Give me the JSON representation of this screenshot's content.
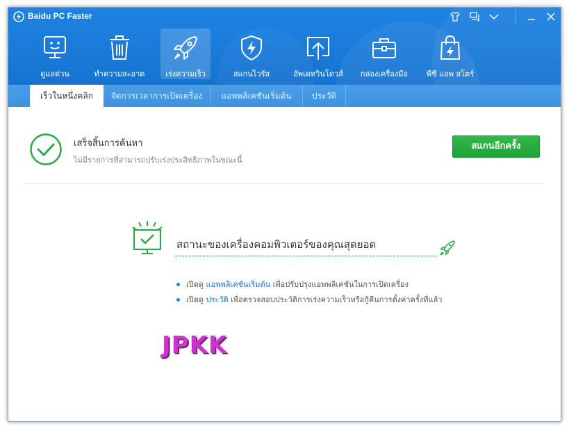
{
  "window": {
    "title": "Baidu PC Faster"
  },
  "nav": [
    {
      "label": "ดูแลด่วน",
      "icon": "monitor-face-icon"
    },
    {
      "label": "ทำความสะอาด",
      "icon": "trash-icon"
    },
    {
      "label": "เร่งความเร็ว",
      "icon": "rocket-icon"
    },
    {
      "label": "สแกนไวรัส",
      "icon": "shield-bolt-icon"
    },
    {
      "label": "อัพเดทวินโดวส์",
      "icon": "upload-icon"
    },
    {
      "label": "กล่องเครื่องมือ",
      "icon": "toolbox-icon"
    },
    {
      "label": "พีซี แอพ สโตร์",
      "icon": "shopping-bag-icon"
    }
  ],
  "tabs": [
    {
      "label": "เร็วในหนึ่งคลิก"
    },
    {
      "label": "จัดการเวลาการเปิดเครื่อง"
    },
    {
      "label": "แอพพลิเคชันเริ่มต้น"
    },
    {
      "label": "ประวัติ"
    }
  ],
  "status": {
    "title": "เสร็จสิ้นการค้นหา",
    "subtitle": "ไม่มีรายการที่สามารถปรับเร่งประสิทธิภาพในขณะนี้",
    "button": "สแกนอีกครั้ง"
  },
  "optimal": {
    "text": "สถานะของเครื่องคอมพิวเตอร์ของคุณสุดยอด"
  },
  "tips": [
    {
      "prefix": "เปิดดู",
      "link": "แอพพลิเคชันเริ่มต้น",
      "suffix": "เพื่อปรับปรุงแอพพลิเคชันในการเปิดเครื่อง"
    },
    {
      "prefix": "เปิดดู",
      "link": "ประวัติ",
      "suffix": "เพื่อตรวจสอบประวัติการเร่งความเร็วหรือกู้คืนการตั้งค่าครั้งที่แล้ว"
    }
  ],
  "watermark": "JPKK",
  "colors": {
    "header_blue": "#1a7ad8",
    "tab_blue": "#4a9de8",
    "green": "#2aaa48",
    "link": "#1a6fcf"
  }
}
